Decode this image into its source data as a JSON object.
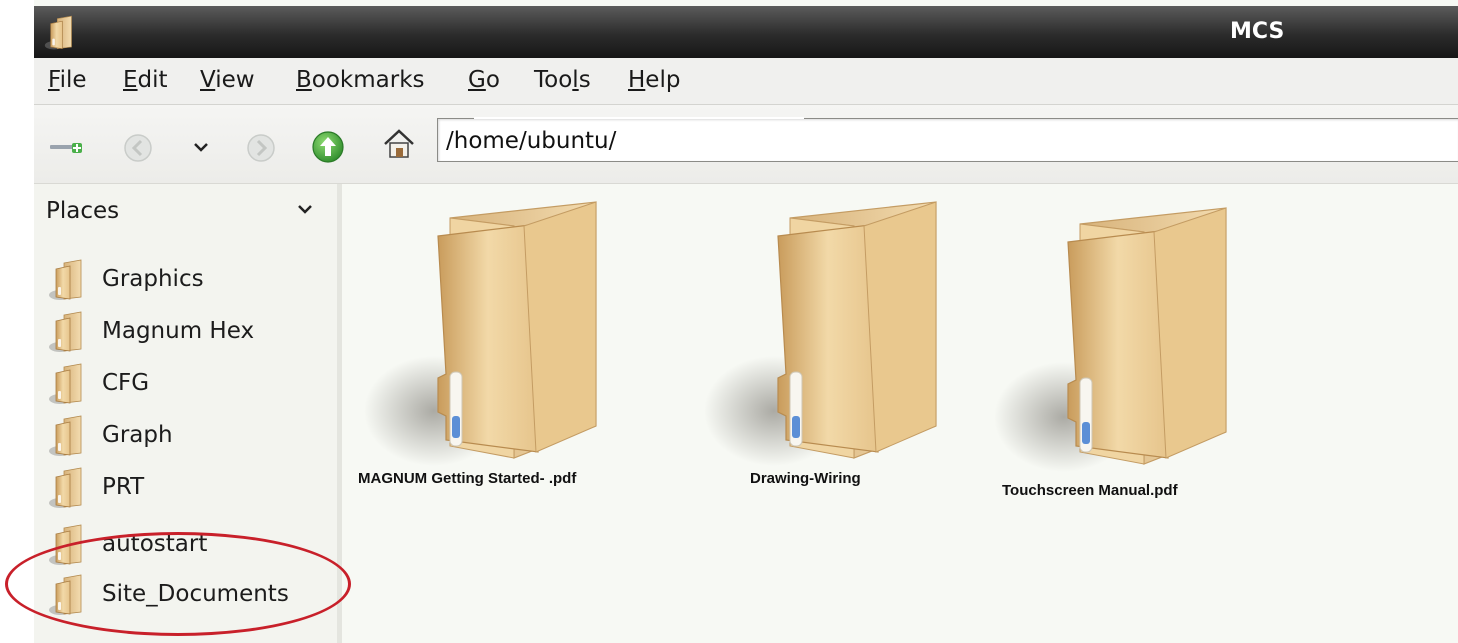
{
  "window": {
    "title": "MCS"
  },
  "menubar": {
    "items": [
      {
        "mnemonic": "F",
        "rest": "ile"
      },
      {
        "mnemonic": "E",
        "rest": "dit"
      },
      {
        "mnemonic": "V",
        "rest": "iew"
      },
      {
        "mnemonic": "B",
        "rest": "ookmarks"
      },
      {
        "mnemonic": "G",
        "rest": "o"
      },
      {
        "pre": "Too",
        "mnemonic": "l",
        "rest": "s"
      },
      {
        "mnemonic": "H",
        "rest": "elp"
      }
    ]
  },
  "toolbar": {
    "location": "/home/ubuntu/",
    "icons": [
      "new-tab-icon",
      "back-icon",
      "history-dropdown-icon",
      "forward-icon",
      "up-icon",
      "home-icon"
    ]
  },
  "sidebar": {
    "header": "Places",
    "items": [
      {
        "label": "Graphics"
      },
      {
        "label": "Magnum Hex"
      },
      {
        "label": "CFG"
      },
      {
        "label": "Graph"
      },
      {
        "label": "PRT"
      },
      {
        "label": "autostart"
      },
      {
        "label": "Site_Documents"
      }
    ]
  },
  "main": {
    "files": [
      {
        "label": "MAGNUM Getting Started- .pdf"
      },
      {
        "label": "Drawing-Wiring"
      },
      {
        "label": "Touchscreen Manual.pdf"
      }
    ]
  },
  "colors": {
    "titlebar": "#2c2c2c",
    "folder": "#e8c995",
    "up_button": "#3fa13a",
    "annotation": "#c8202a"
  }
}
